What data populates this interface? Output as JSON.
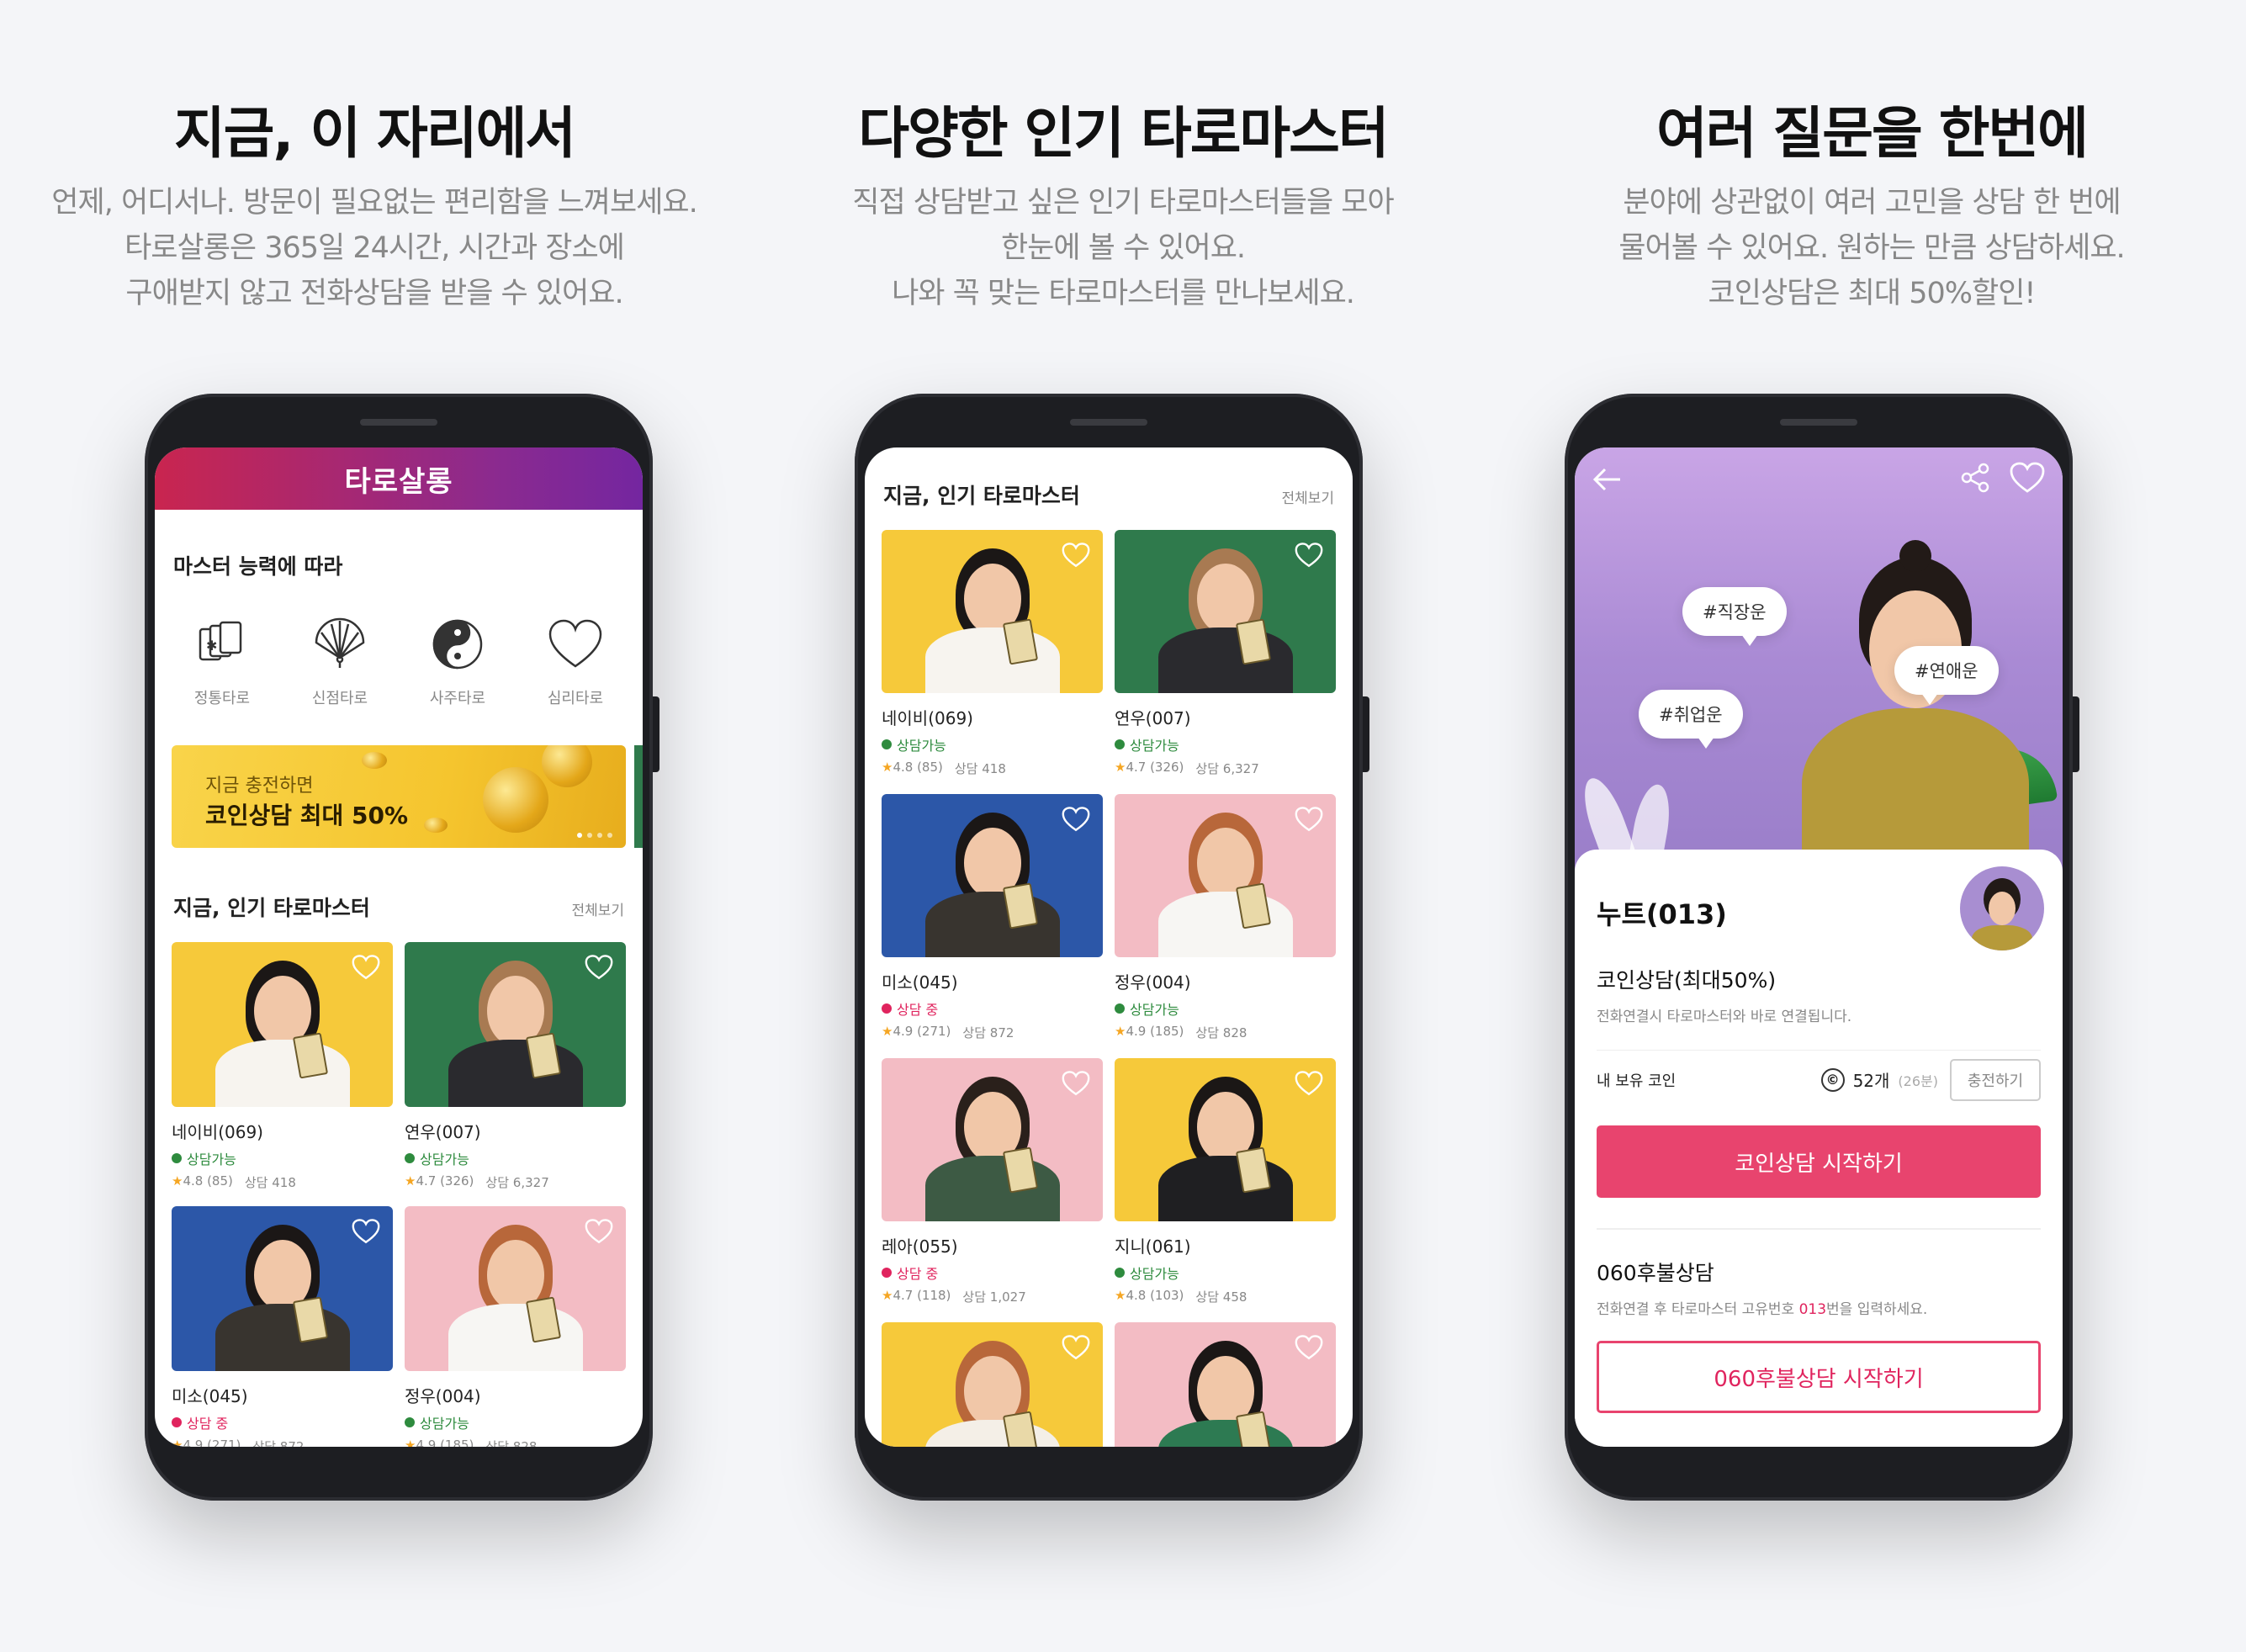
{
  "panels": [
    {
      "headline": "지금, 이 자리에서",
      "desc": [
        "언제, 어디서나. 방문이 필요없는 편리함을 느껴보세요.",
        "타로살롱은 365일 24시간, 시간과 장소에",
        "구애받지 않고 전화상담을 받을 수 있어요."
      ]
    },
    {
      "headline": "다양한 인기 타로마스터",
      "desc": [
        "직접 상담받고 싶은 인기 타로마스터들을 모아",
        "한눈에 볼 수 있어요.",
        "나와 꼭 맞는 타로마스터를 만나보세요."
      ]
    },
    {
      "headline": "여러 질문을 한번에",
      "desc": [
        "분야에 상관없이 여러 고민을 상담 한 번에",
        "물어볼 수 있어요. 원하는 만큼 상담하세요.",
        "코인상담은 최대 50%할인!"
      ]
    }
  ],
  "home": {
    "app_title": "타로살롱",
    "category_title": "마스터 능력에 따라",
    "categories": [
      {
        "label": "정통타로",
        "icon": "tarot-cards-icon"
      },
      {
        "label": "신점타로",
        "icon": "fan-icon"
      },
      {
        "label": "사주타로",
        "icon": "yin-yang-icon"
      },
      {
        "label": "심리타로",
        "icon": "heart-icon"
      }
    ],
    "banner": {
      "line1": "지금 충전하면",
      "line2": "코인상담 최대 50%",
      "slide_count": 4,
      "active_slide": 1
    },
    "list_title": "지금, 인기 타로마스터",
    "more_label": "전체보기"
  },
  "masters": [
    {
      "name": "네이비(069)",
      "status": "상담가능",
      "available": true,
      "rating": "4.8 (85)",
      "count": "상담 418",
      "bg": "#f6c93a",
      "hair": "#1b1716",
      "top": "#f7f4ef"
    },
    {
      "name": "연우(007)",
      "status": "상담가능",
      "available": true,
      "rating": "4.7 (326)",
      "count": "상담 6,327",
      "bg": "#2f7a4c",
      "hair": "#a87a52",
      "top": "#2a2a2e"
    },
    {
      "name": "미소(045)",
      "status": "상담 중",
      "available": false,
      "rating": "4.9 (271)",
      "count": "상담 872",
      "bg": "#2c57a8",
      "hair": "#1b1716",
      "top": "#38342f"
    },
    {
      "name": "정우(004)",
      "status": "상담가능",
      "available": true,
      "rating": "4.9 (185)",
      "count": "상담 828",
      "bg": "#f3bcc4",
      "hair": "#b8673a",
      "top": "#f7f6f3"
    },
    {
      "name": "레아(055)",
      "status": "상담 중",
      "available": false,
      "rating": "4.7 (118)",
      "count": "상담 1,027",
      "bg": "#f3bcc4",
      "hair": "#2a201b",
      "top": "#3d5a44"
    },
    {
      "name": "지니(061)",
      "status": "상담가능",
      "available": true,
      "rating": "4.8 (103)",
      "count": "상담 458",
      "bg": "#f6c93a",
      "hair": "#1b1716",
      "top": "#1f1f22"
    },
    {
      "name": "",
      "status": "",
      "available": true,
      "rating": "",
      "count": "",
      "bg": "#f6c93a",
      "hair": "#b8673a",
      "top": "#f4efe7"
    },
    {
      "name": "",
      "status": "",
      "available": true,
      "rating": "",
      "count": "",
      "bg": "#f3bcc4",
      "hair": "#1b1716",
      "top": "#2d7a52"
    }
  ],
  "detail": {
    "tags": [
      "#직장운",
      "#연애운",
      "#취업운"
    ],
    "name": "누트(013)",
    "coin_title": "코인상담(최대50%)",
    "coin_sub": "전화연결시 타로마스터와 바로 연결됩니다.",
    "my_coin_label": "내 보유 코인",
    "coin_icon": "©",
    "coin_amount": "52개",
    "coin_minutes": "(26분)",
    "charge_label": "충전하기",
    "start_coin_button": "코인상담 시작하기",
    "postpay_title": "060후불상담",
    "postpay_sub_pre": "전화연결 후 타로마스터 고유번호 ",
    "postpay_code": "013",
    "postpay_sub_post": "번을 입력하세요.",
    "start_postpay_button": "060후불상담 시작하기"
  },
  "colors": {
    "brand_pink": "#e8446e",
    "available_green": "#2e8b3e",
    "busy_red": "#e0245e",
    "hero_purple": "#b297dc"
  }
}
